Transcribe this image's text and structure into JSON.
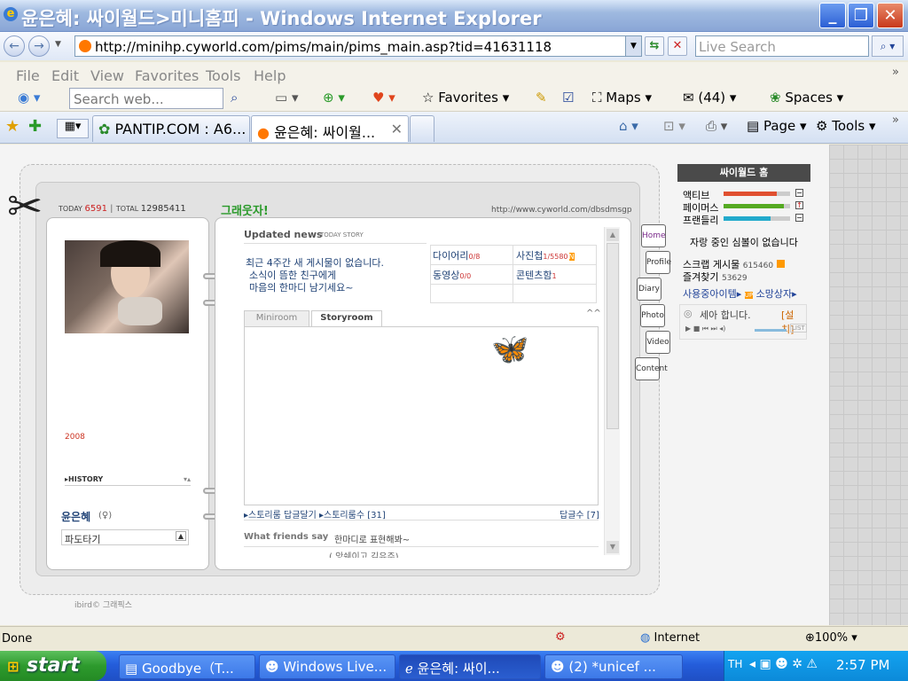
{
  "window": {
    "title": "윤은혜: 싸이월드>미니홈피 - Windows Internet Explorer"
  },
  "address": {
    "url": "http://minihp.cyworld.com/pims/main/pims_main.asp?tid=41631118"
  },
  "search": {
    "placeholder": "Live Search"
  },
  "menu": [
    "File",
    "Edit",
    "View",
    "Favorites",
    "Tools",
    "Help"
  ],
  "linksbar": {
    "search_placeholder": "Search web...",
    "favorites": "Favorites",
    "maps": "Maps",
    "mail_count": "(44)",
    "spaces": "Spaces"
  },
  "tabs": [
    {
      "label": "PANTIP.COM : A6..."
    },
    {
      "label": "윤은혜: 싸이월..."
    }
  ],
  "command": {
    "page": "Page",
    "tools": "Tools"
  },
  "minihp": {
    "today_label": "TODAY",
    "today": "6591",
    "total_label": "TOTAL",
    "total": "12985411",
    "site_title": "그래웃자!",
    "site_url": "http://www.cyworld.com/dbsdmsgp",
    "year": "2008",
    "history": "HISTORY",
    "owner": "윤은혜",
    "owner_sym": "(♀)",
    "mood": "파도타기",
    "updated_news": "Updated news",
    "today_story": "TODAY STORY",
    "news_lines": [
      "최근 4주간 새 게시물이 없습니다.",
      "소식이 뜸한 친구에게",
      "마음의 한마디 남기세요~"
    ],
    "stats": [
      {
        "label": "다이어리",
        "count": "0/8"
      },
      {
        "label": "사진첩",
        "count": "1/5580"
      },
      {
        "label": "동영상",
        "count": "0/0"
      },
      {
        "label": "콘텐츠함",
        "count": "1"
      }
    ],
    "tab_miniroom": "Miniroom",
    "tab_storyroom": "Storyroom",
    "collapse": "^^",
    "story_reply": "스토리룸 답글달기",
    "story_count": "스토리룸수 [31]",
    "reply_count": "답글수 [7]",
    "friends_say": "What friends say",
    "friends_hint": "한마디로 표현해봐~",
    "friends_line": "( 앙쉐이고 김유주)",
    "side_tabs": [
      "Home",
      "Profile",
      "Diary",
      "Photo",
      "Video",
      "Content"
    ],
    "copyright": "ibird© 그래픽스"
  },
  "right": {
    "home": "싸이월드 홈",
    "active": "액티브",
    "fame": "페이머스",
    "friendly": "프랜들리",
    "symbol": "자랑 중인 심볼이 없습니다",
    "scrap_label": "스크랩 게시물",
    "scrap": "615460",
    "fav_label": "즐겨찾기",
    "fav": "53629",
    "items": "사용중아이템",
    "wish": "소망상자",
    "bgm": "세아 합니다.",
    "install": "[설치]",
    "list": "LIST"
  },
  "status": {
    "left": "Done",
    "zone": "Internet",
    "zoom": "100%"
  },
  "taskbar": {
    "start": "start",
    "items": [
      "Goodbye（T...",
      "Windows Live...",
      "윤은혜: 싸이...",
      "(2) *unicef ..."
    ],
    "lang": "TH",
    "clock": "2:57 PM"
  },
  "colors": {
    "title_blue": "#8aa6d6",
    "task_blue": "#245ddb",
    "start_green": "#2d9a2d",
    "site_green": "#2a9a2a",
    "active_bar": "#e05030",
    "fame_bar": "#55aa22",
    "friendly_bar": "#22aacc"
  }
}
